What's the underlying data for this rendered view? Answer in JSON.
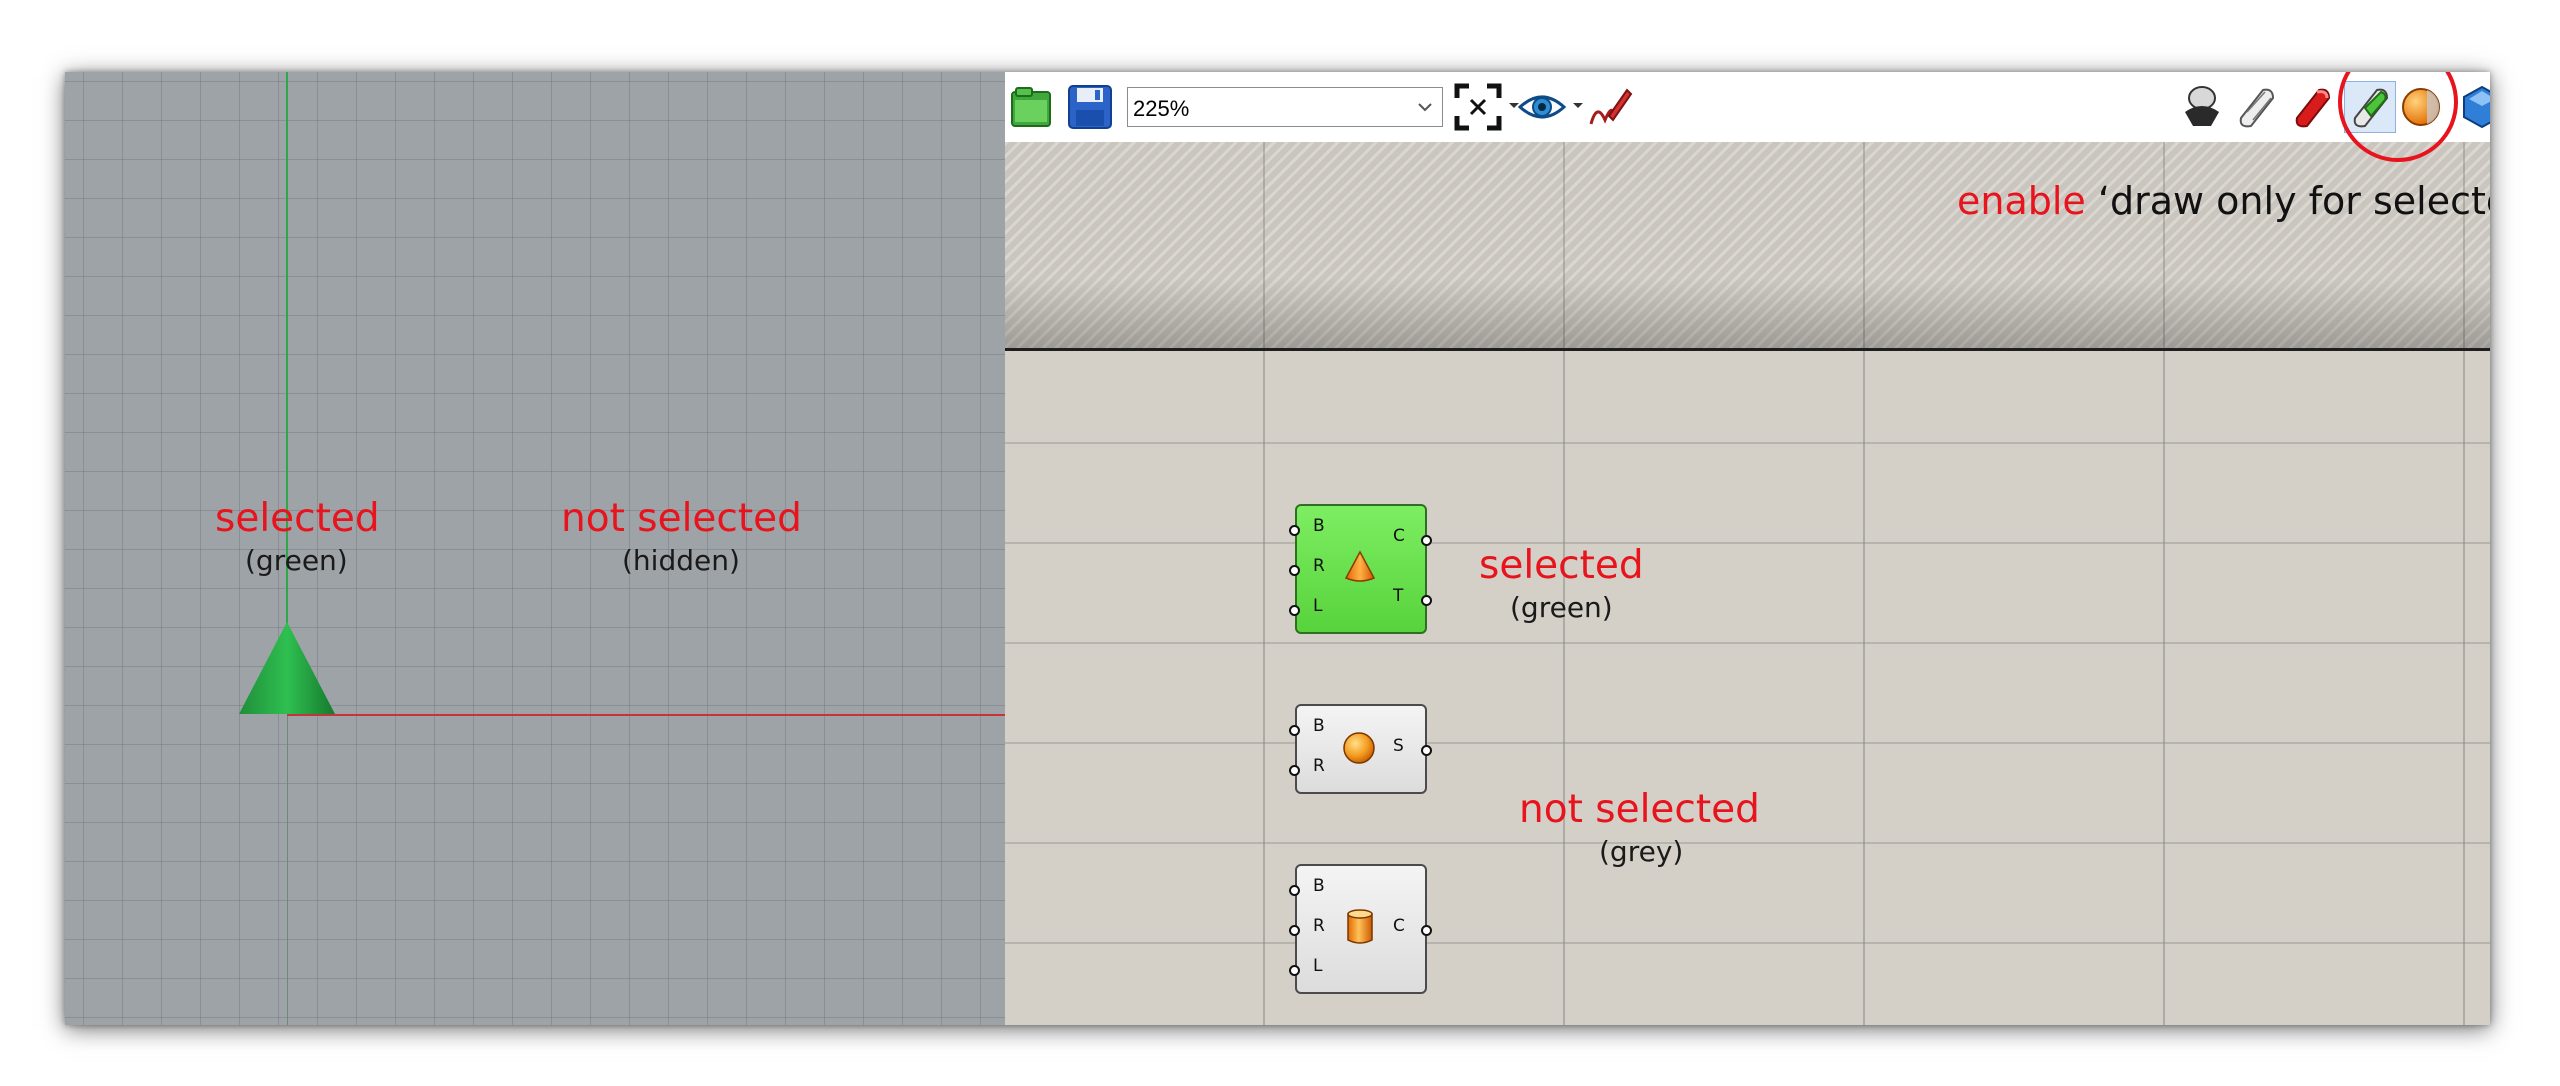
{
  "viewport": {
    "selected_label": "selected",
    "selected_sub": "(green)",
    "not_selected_label": "not selected",
    "not_selected_sub": "(hidden)"
  },
  "toolbar": {
    "zoom_value": "225%",
    "icons": [
      "open-file-icon",
      "save-icon",
      "zoom-extents-icon",
      "eye-icon",
      "sketch-pen-icon",
      "preview-off-icon",
      "wireframe-preview-icon",
      "shaded-preview-icon",
      "draw-only-selected-icon",
      "custom-preview-icon",
      "geometry-display-icon"
    ]
  },
  "annotation": {
    "enable_word": "enable",
    "quoted_text": "‘draw only for selected’"
  },
  "components": {
    "cone": {
      "inputs": [
        "B",
        "R",
        "L"
      ],
      "outputs": [
        "C",
        "T"
      ],
      "state_label": "selected",
      "state_sub": "(green)"
    },
    "sphere": {
      "inputs": [
        "B",
        "R"
      ],
      "outputs": [
        "S"
      ]
    },
    "cylinder": {
      "inputs": [
        "B",
        "R",
        "L"
      ],
      "outputs": [
        "C"
      ],
      "state_label": "not selected",
      "state_sub": "(grey)"
    }
  },
  "colors": {
    "annotation_red": "#e8141d",
    "selected_green": "#58d33c",
    "viewport_bg": "#9ea3a8",
    "canvas_bg": "#d4d0c8"
  }
}
